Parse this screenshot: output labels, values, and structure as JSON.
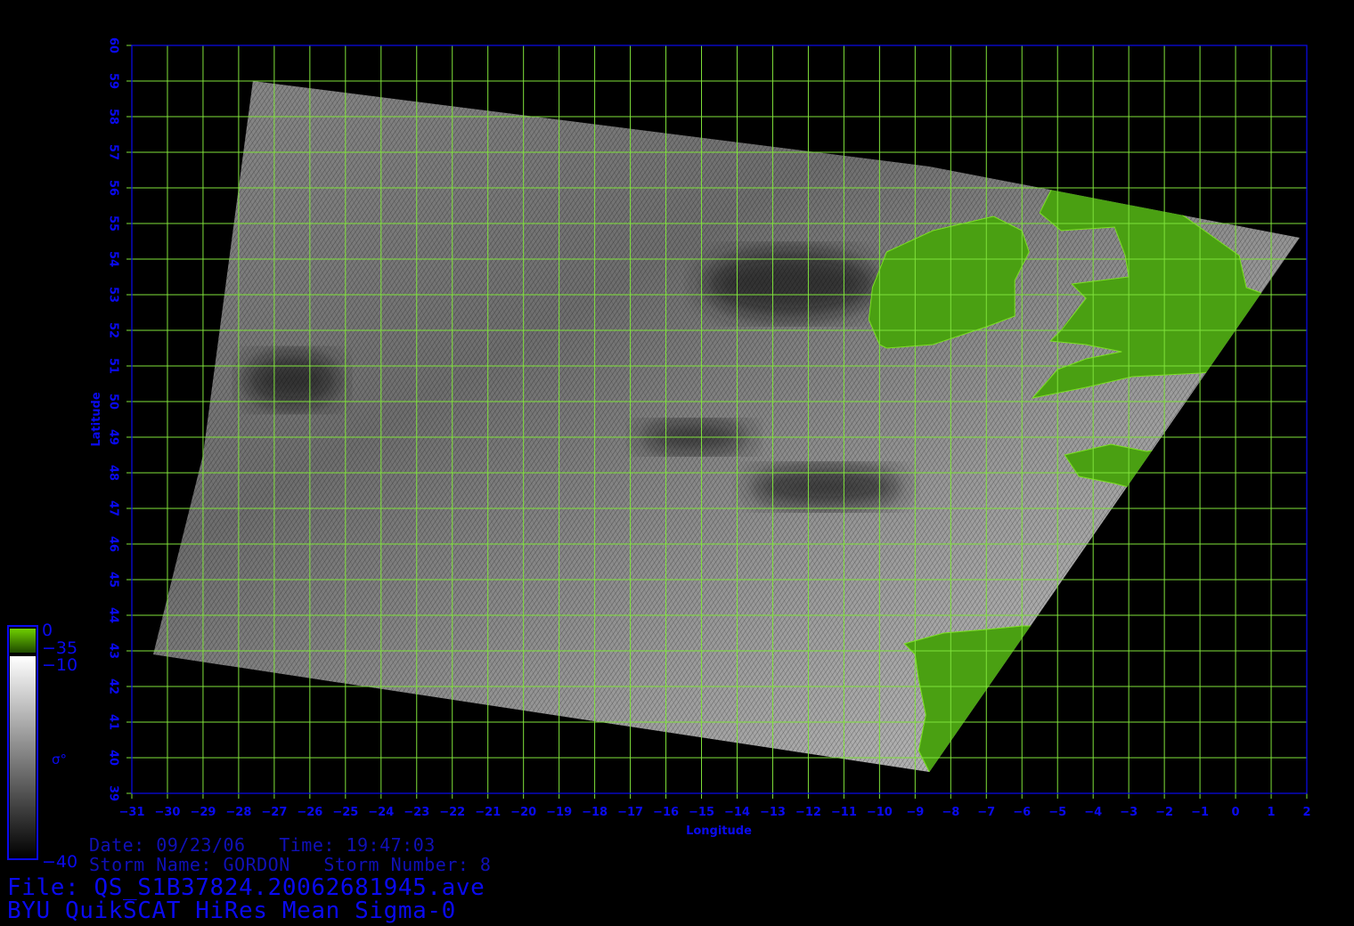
{
  "colors": {
    "background": "#000000",
    "grid": "#7fe23a",
    "axis_text": "#0a0af0",
    "land": "#4aa012"
  },
  "map": {
    "lon_range": [
      -31,
      2
    ],
    "lat_range": [
      39,
      60
    ],
    "lon_ticks": [
      -31,
      -30,
      -29,
      -28,
      -27,
      -26,
      -25,
      -24,
      -23,
      -22,
      -21,
      -20,
      -19,
      -18,
      -17,
      -16,
      -15,
      -14,
      -13,
      -12,
      -11,
      -10,
      -9,
      -8,
      -7,
      -6,
      -5,
      -4,
      -3,
      -2,
      -1,
      0,
      1,
      2
    ],
    "lat_ticks": [
      39,
      40,
      41,
      42,
      43,
      44,
      45,
      46,
      47,
      48,
      49,
      50,
      51,
      52,
      53,
      54,
      55,
      56,
      57,
      58,
      59,
      60
    ],
    "xlabel": "Longitude",
    "ylabel": "Latitude",
    "swath_corners_lonlat": [
      [
        -27.6,
        59.0
      ],
      [
        -8.6,
        56.6
      ],
      [
        1.8,
        54.6
      ],
      [
        -8.6,
        39.6
      ],
      [
        -30.4,
        42.9
      ],
      [
        -29.0,
        48.5
      ]
    ],
    "land_regions": [
      {
        "name": "ireland",
        "outline_lonlat": [
          [
            -10.0,
            51.6
          ],
          [
            -10.3,
            52.3
          ],
          [
            -10.2,
            53.2
          ],
          [
            -9.8,
            54.2
          ],
          [
            -8.5,
            54.8
          ],
          [
            -6.8,
            55.2
          ],
          [
            -6.0,
            54.8
          ],
          [
            -5.8,
            54.2
          ],
          [
            -6.2,
            53.4
          ],
          [
            -6.2,
            52.4
          ],
          [
            -7.0,
            52.1
          ],
          [
            -8.5,
            51.6
          ],
          [
            -9.8,
            51.5
          ]
        ]
      },
      {
        "name": "great-britain",
        "outline_lonlat": [
          [
            -5.7,
            50.1
          ],
          [
            -4.2,
            50.4
          ],
          [
            -2.9,
            50.7
          ],
          [
            -1.0,
            50.8
          ],
          [
            0.9,
            51.0
          ],
          [
            1.6,
            51.6
          ],
          [
            1.7,
            52.7
          ],
          [
            0.3,
            53.2
          ],
          [
            0.1,
            54.1
          ],
          [
            -0.6,
            54.6
          ],
          [
            -2.0,
            55.6
          ],
          [
            -2.5,
            55.9
          ],
          [
            -3.3,
            56.1
          ],
          [
            -5.0,
            56.3
          ],
          [
            -5.5,
            55.3
          ],
          [
            -4.9,
            54.8
          ],
          [
            -3.4,
            54.9
          ],
          [
            -3.1,
            54.1
          ],
          [
            -3.0,
            53.5
          ],
          [
            -4.6,
            53.3
          ],
          [
            -4.2,
            52.9
          ],
          [
            -4.9,
            52.0
          ],
          [
            -5.2,
            51.7
          ],
          [
            -4.2,
            51.6
          ],
          [
            -3.2,
            51.4
          ],
          [
            -4.2,
            51.2
          ],
          [
            -5.0,
            50.9
          ]
        ]
      },
      {
        "name": "brittany",
        "outline_lonlat": [
          [
            -4.8,
            48.5
          ],
          [
            -3.5,
            48.8
          ],
          [
            -2.5,
            48.6
          ],
          [
            -1.8,
            48.7
          ],
          [
            -2.1,
            47.8
          ],
          [
            -2.6,
            47.5
          ],
          [
            -3.4,
            47.7
          ],
          [
            -4.4,
            47.9
          ]
        ]
      },
      {
        "name": "iberia",
        "outline_lonlat": [
          [
            -9.0,
            42.9
          ],
          [
            -9.3,
            43.2
          ],
          [
            -8.2,
            43.5
          ],
          [
            -7.0,
            43.6
          ],
          [
            -6.0,
            43.7
          ],
          [
            -5.2,
            43.7
          ],
          [
            -6.5,
            41.5
          ],
          [
            -7.7,
            39.7
          ],
          [
            -8.6,
            39.6
          ],
          [
            -8.9,
            40.2
          ],
          [
            -8.7,
            41.2
          ],
          [
            -8.9,
            42.2
          ]
        ]
      }
    ],
    "dark_patches_lonlat": [
      {
        "name": "low-pressure-core",
        "lon": -15.2,
        "lat": 49.0,
        "rx_deg": 1.6,
        "ry_deg": 0.45
      },
      {
        "name": "western-band",
        "lon": -26.5,
        "lat": 50.6,
        "rx_deg": 1.4,
        "ry_deg": 0.8
      },
      {
        "name": "northern-dark-area",
        "lon": -12.5,
        "lat": 53.3,
        "rx_deg": 2.5,
        "ry_deg": 1.0
      },
      {
        "name": "frontal-band",
        "lon": -11.5,
        "lat": 47.6,
        "rx_deg": 2.2,
        "ry_deg": 0.6
      }
    ]
  },
  "colorbar": {
    "label": "σ°",
    "land_top": "0",
    "land_bottom": "−35",
    "ocean_top": "−10",
    "ocean_bottom": "−40"
  },
  "info": {
    "date_line": "Date: 09/23/06   Time: 19:47:03",
    "storm_line": "Storm Name: GORDON   Storm Number: 8",
    "file_line": "File: QS_S1B37824.20062681945.ave",
    "title_line": "BYU QuikSCAT HiRes Mean Sigma-0"
  }
}
